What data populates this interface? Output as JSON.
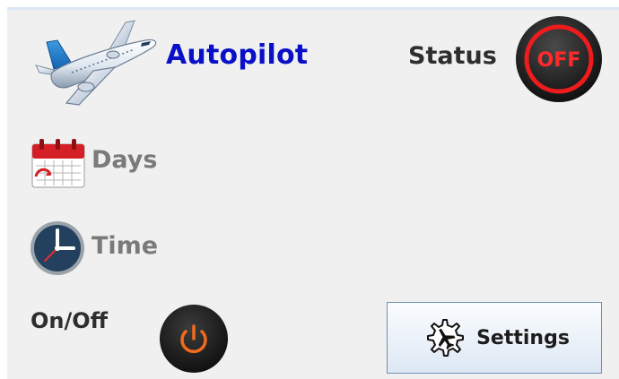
{
  "header": {
    "title": "Autopilot",
    "status_label": "Status",
    "status_value": "OFF",
    "plane_icon": "airplane-icon"
  },
  "schedule": {
    "days_label": "Days",
    "days_icon": "calendar-icon",
    "time_label": "Time",
    "time_icon": "clock-icon"
  },
  "controls": {
    "onoff_label": "On/Off",
    "power_icon": "power-icon",
    "settings_label": "Settings",
    "settings_icon": "gear-airplane-icon"
  },
  "colors": {
    "title": "#0a10c8",
    "status_off": "#ee1c1c",
    "power_glyph": "#f26b1d",
    "muted_text": "#7a7a7a",
    "panel_bg": "#f0f0f0"
  }
}
